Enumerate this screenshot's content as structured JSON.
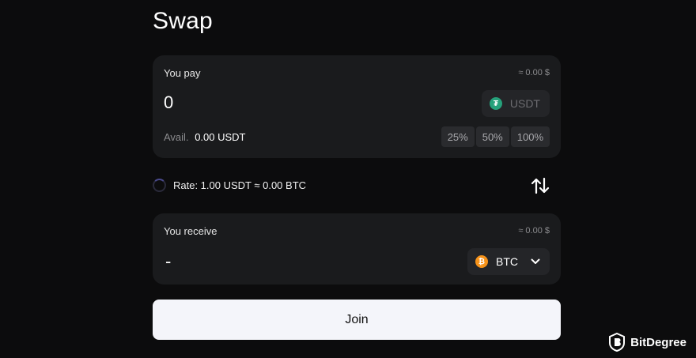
{
  "page": {
    "title": "Swap"
  },
  "pay": {
    "label": "You pay",
    "usd_value": "≈ 0.00 $",
    "amount": "0",
    "token": {
      "symbol": "USDT",
      "icon": "tether-icon",
      "color": "#26a17b"
    },
    "available_label": "Avail.",
    "available_value": "0.00 USDT",
    "percent_buttons": [
      "25%",
      "50%",
      "100%"
    ]
  },
  "rate": {
    "text": "Rate: 1.00 USDT ≈ 0.00 BTC"
  },
  "receive": {
    "label": "You receive",
    "usd_value": "≈ 0.00 $",
    "amount": "-",
    "token": {
      "symbol": "BTC",
      "icon": "bitcoin-icon",
      "color": "#f7931a"
    }
  },
  "action": {
    "label": "Join"
  },
  "watermark": {
    "text": "BitDegree"
  },
  "colors": {
    "background": "#0c0c0d",
    "card": "#1a1b1d",
    "button": "#f4f5fa"
  }
}
